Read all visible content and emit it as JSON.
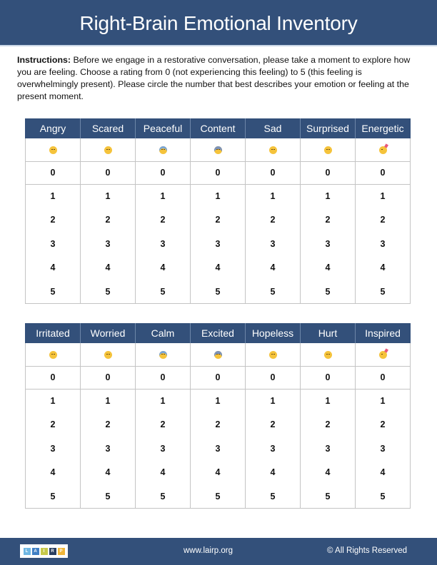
{
  "title": "Right-Brain Emotional Inventory",
  "instructions": {
    "label": "Instructions:",
    "text": " Before we engage in a restorative conversation, please take a moment to explore how you are feeling. Choose a rating from 0 (not experiencing this feeling) to 5 (this feeling is overwhelmingly present). Please circle the number that best describes your emotion or feeling at the present moment."
  },
  "emojis": [
    {
      "name": "angry-face-icon",
      "glyph": "😠",
      "style": "angry"
    },
    {
      "name": "pensive-face-icon",
      "glyph": "😔",
      "style": "sad"
    },
    {
      "name": "downcast-sweat-face-icon",
      "glyph": "😓",
      "style": "sweat"
    },
    {
      "name": "fearful-face-icon",
      "glyph": "😨",
      "style": "fear"
    },
    {
      "name": "flushed-face-icon",
      "glyph": "😳",
      "style": "flushed"
    },
    {
      "name": "slightly-smiling-face-icon",
      "glyph": "🙂",
      "style": "smile"
    },
    {
      "name": "partying-face-icon",
      "glyph": "🥳",
      "style": "party"
    }
  ],
  "ratings": [
    "0",
    "1",
    "2",
    "3",
    "4",
    "5"
  ],
  "tables": [
    {
      "headers": [
        "Angry",
        "Scared",
        "Peaceful",
        "Content",
        "Sad",
        "Surprised",
        "Energetic"
      ]
    },
    {
      "headers": [
        "Irritated",
        "Worried",
        "Calm",
        "Excited",
        "Hopeless",
        "Hurt",
        "Inspired"
      ]
    }
  ],
  "footer": {
    "logo_letters": [
      {
        "letter": "L",
        "color": "#6fb7e3"
      },
      {
        "letter": "A",
        "color": "#3f7fc4"
      },
      {
        "letter": "I",
        "color": "#c6c84a"
      },
      {
        "letter": "R",
        "color": "#2a3f60"
      },
      {
        "letter": "P",
        "color": "#f0b63a"
      }
    ],
    "url": "www.lairp.org",
    "rights": "© All Rights Reserved"
  },
  "colors": {
    "brand": "#33507a",
    "grid": "#c4c4c4"
  }
}
